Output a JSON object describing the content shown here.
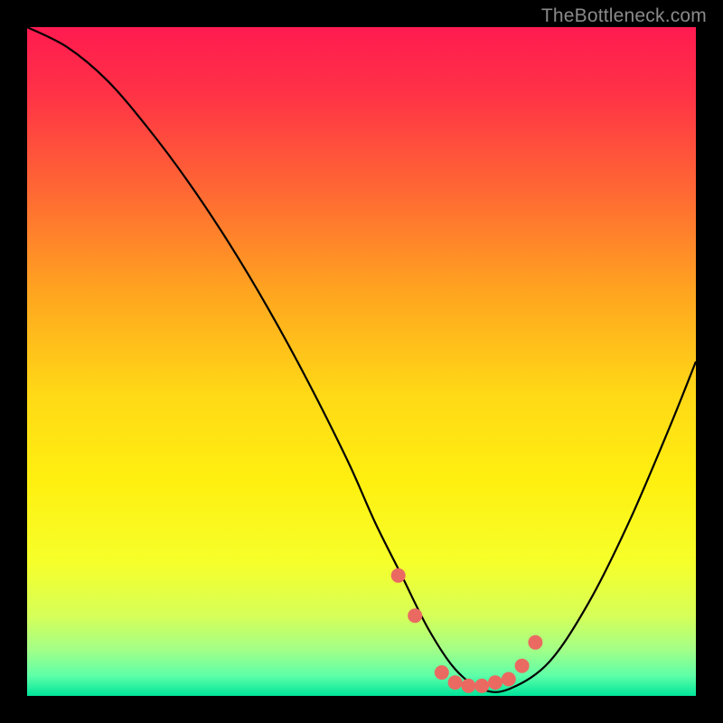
{
  "watermark": "TheBottleneck.com",
  "colors": {
    "frame": "#000000",
    "curve": "#000000",
    "marker": "#ea6a62",
    "gradient_stops": [
      {
        "offset": 0.0,
        "color": "#ff1b50"
      },
      {
        "offset": 0.1,
        "color": "#ff3246"
      },
      {
        "offset": 0.25,
        "color": "#ff6a33"
      },
      {
        "offset": 0.4,
        "color": "#ffa61f"
      },
      {
        "offset": 0.55,
        "color": "#ffd916"
      },
      {
        "offset": 0.68,
        "color": "#fff010"
      },
      {
        "offset": 0.8,
        "color": "#f6ff2a"
      },
      {
        "offset": 0.88,
        "color": "#d6ff58"
      },
      {
        "offset": 0.93,
        "color": "#a4ff86"
      },
      {
        "offset": 0.97,
        "color": "#5effa8"
      },
      {
        "offset": 1.0,
        "color": "#00e59a"
      }
    ]
  },
  "chart_data": {
    "type": "line",
    "title": "",
    "xlabel": "",
    "ylabel": "",
    "xlim": [
      0,
      100
    ],
    "ylim": [
      0,
      100
    ],
    "grid": false,
    "legend": false,
    "series": [
      {
        "name": "bottleneck-curve",
        "x": [
          0,
          6,
          12,
          18,
          24,
          30,
          36,
          42,
          48,
          52,
          56,
          60,
          64,
          68,
          72,
          78,
          84,
          90,
          96,
          100
        ],
        "y": [
          100,
          97,
          92,
          85,
          77,
          68,
          58,
          47,
          35,
          26,
          18,
          10,
          4,
          1,
          1,
          5,
          14,
          26,
          40,
          50
        ]
      }
    ],
    "markers": {
      "name": "highlight-points",
      "x": [
        55.5,
        58,
        62,
        64,
        66,
        68,
        70,
        72,
        74,
        76
      ],
      "y": [
        18,
        12,
        3.5,
        2,
        1.5,
        1.5,
        2,
        2.5,
        4.5,
        8
      ]
    }
  }
}
